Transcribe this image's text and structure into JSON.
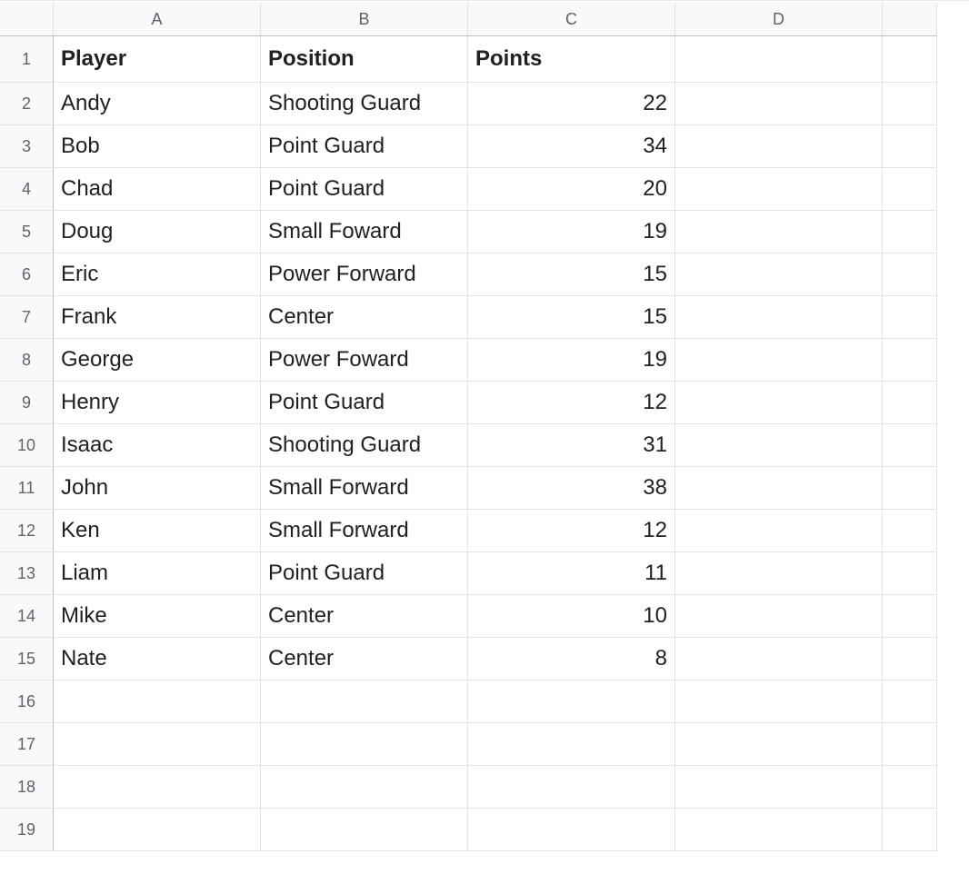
{
  "columns": [
    "A",
    "B",
    "C",
    "D",
    ""
  ],
  "row_numbers": [
    1,
    2,
    3,
    4,
    5,
    6,
    7,
    8,
    9,
    10,
    11,
    12,
    13,
    14,
    15,
    16,
    17,
    18,
    19
  ],
  "headers": {
    "a": "Player",
    "b": "Position",
    "c": "Points"
  },
  "rows": [
    {
      "a": "Andy",
      "b": "Shooting Guard",
      "c": 22
    },
    {
      "a": "Bob",
      "b": "Point Guard",
      "c": 34
    },
    {
      "a": "Chad",
      "b": "Point Guard",
      "c": 20
    },
    {
      "a": "Doug",
      "b": "Small Foward",
      "c": 19
    },
    {
      "a": "Eric",
      "b": "Power Forward",
      "c": 15
    },
    {
      "a": "Frank",
      "b": "Center",
      "c": 15
    },
    {
      "a": "George",
      "b": "Power Foward",
      "c": 19
    },
    {
      "a": "Henry",
      "b": "Point Guard",
      "c": 12
    },
    {
      "a": "Isaac",
      "b": "Shooting Guard",
      "c": 31
    },
    {
      "a": "John",
      "b": "Small Forward",
      "c": 38
    },
    {
      "a": "Ken",
      "b": "Small Forward",
      "c": 12
    },
    {
      "a": "Liam",
      "b": "Point Guard",
      "c": 11
    },
    {
      "a": "Mike",
      "b": "Center",
      "c": 10
    },
    {
      "a": "Nate",
      "b": "Center",
      "c": 8
    }
  ],
  "empty_rows_after": 4
}
